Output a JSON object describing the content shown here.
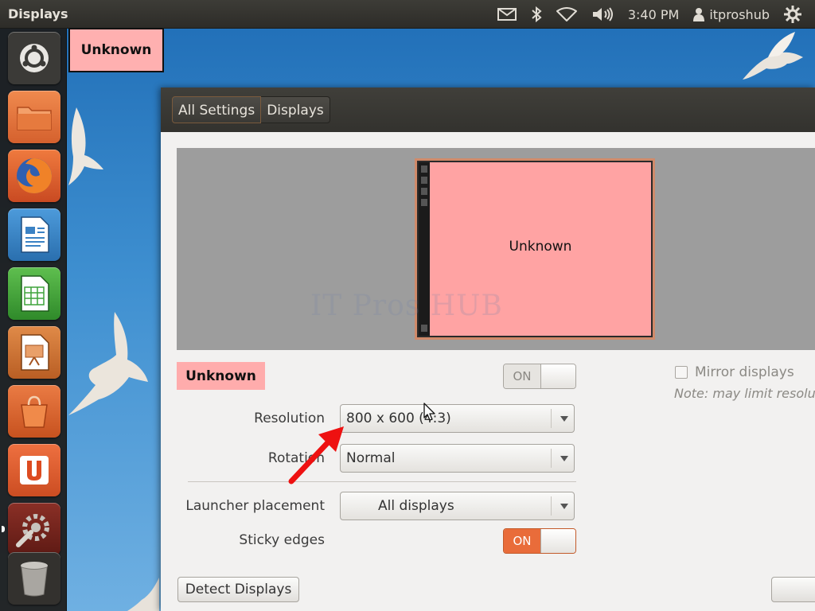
{
  "top_panel": {
    "app_title": "Displays",
    "clock": "3:40 PM",
    "user": "itproshub",
    "tray_icons": [
      "mail-icon",
      "bluetooth-icon",
      "wifi-icon",
      "volume-icon",
      "user-icon",
      "gear-icon"
    ]
  },
  "launcher": {
    "items": [
      {
        "name": "dash-home-icon",
        "color": "#3a3936"
      },
      {
        "name": "files-icon",
        "color": "#e8723a"
      },
      {
        "name": "firefox-icon",
        "color": "#d9582a"
      },
      {
        "name": "writer-icon",
        "color": "#3b87c9"
      },
      {
        "name": "calc-icon",
        "color": "#3ea33a"
      },
      {
        "name": "impress-icon",
        "color": "#c8702f"
      },
      {
        "name": "software-center-icon",
        "color": "#d5632b"
      },
      {
        "name": "ubuntu-one-icon",
        "color": "#d6542a"
      },
      {
        "name": "system-settings-icon",
        "color": "#8a2a22"
      },
      {
        "name": "trash-icon",
        "color": "#3a3936"
      }
    ]
  },
  "identify_label": "Unknown",
  "window": {
    "breadcrumbs": [
      "All Settings",
      "Displays"
    ],
    "preview": {
      "monitor_label": "Unknown",
      "watermark": "IT Pros HUB"
    },
    "display_name": "Unknown",
    "power_switch": "ON",
    "mirror_label": "Mirror displays",
    "mirror_note": "Note: may limit resolu",
    "resolution": {
      "label": "Resolution",
      "value": "800 x 600 (4:3)"
    },
    "rotation": {
      "label": "Rotation",
      "value": "Normal"
    },
    "launcher_placement": {
      "label": "Launcher placement",
      "value": "All displays"
    },
    "sticky_edges": {
      "label": "Sticky edges",
      "value": "ON"
    },
    "detect_button": "Detect Displays"
  },
  "colors": {
    "accent": "#e96c3a",
    "display_highlight": "#ffa3a3",
    "annotation_arrow": "#ee1111"
  }
}
